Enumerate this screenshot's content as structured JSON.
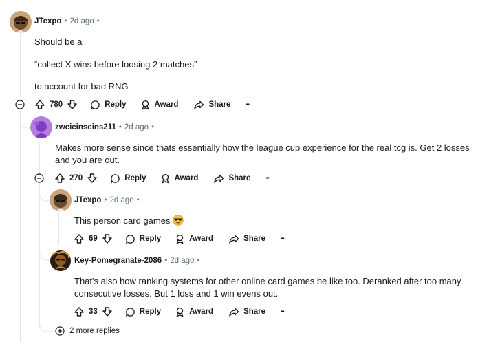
{
  "comments": [
    {
      "user": "JTexpo",
      "time": "2d ago",
      "lines": [
        "Should be a",
        "“collect X wins before loosing 2 matches”",
        "to account for bad RNG"
      ],
      "votes": "780",
      "reply": "Reply",
      "award": "Award",
      "share": "Share"
    },
    {
      "user": "zweieinseins211",
      "time": "2d ago",
      "lines": [
        "Makes more sense since thats essentially how the league cup experience for the real tcg is. Get 2 losses",
        "and you are out."
      ],
      "votes": "270",
      "reply": "Reply",
      "award": "Award",
      "share": "Share"
    },
    {
      "user": "JTexpo",
      "time": "2d ago",
      "lines": [
        "This person card games"
      ],
      "emoji": "smiling-face-with-sunglasses",
      "votes": "69",
      "reply": "Reply",
      "award": "Award",
      "share": "Share"
    },
    {
      "user": "Key-Pomegranate-2086",
      "time": "2d ago",
      "lines": [
        "That's also how ranking systems for other online card games be like too. Deranked after too many",
        "consecutive losses. But 1 loss and 1 win evens out."
      ],
      "votes": "33",
      "reply": "Reply",
      "award": "Award",
      "share": "Share"
    }
  ],
  "more_replies": "2 more replies",
  "separator": "•",
  "overflow": "•••"
}
